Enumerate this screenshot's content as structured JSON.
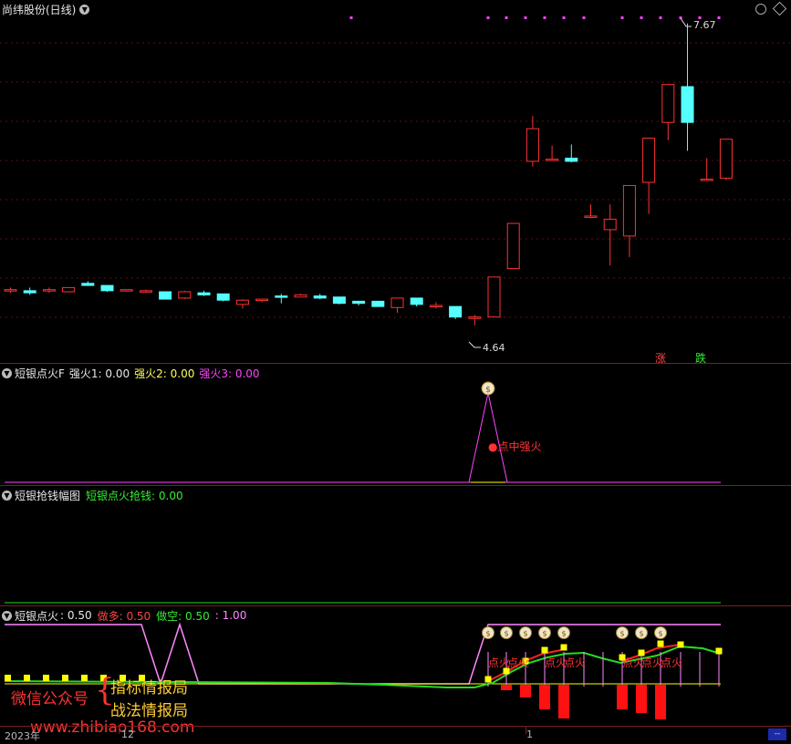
{
  "main": {
    "title": "尚纬股份(日线)",
    "high_label": "7.67",
    "low_label": "4.64",
    "up_label": "涨",
    "down_label": "跌",
    "candles": [
      {
        "o": 5.13,
        "h": 5.16,
        "l": 5.11,
        "c": 5.14
      },
      {
        "o": 5.13,
        "h": 5.16,
        "l": 5.09,
        "c": 5.11
      },
      {
        "o": 5.13,
        "h": 5.16,
        "l": 5.11,
        "c": 5.14
      },
      {
        "o": 5.12,
        "h": 5.16,
        "l": 5.12,
        "c": 5.16
      },
      {
        "o": 5.2,
        "h": 5.22,
        "l": 5.18,
        "c": 5.18
      },
      {
        "o": 5.18,
        "h": 5.18,
        "l": 5.12,
        "c": 5.13
      },
      {
        "o": 5.13,
        "h": 5.14,
        "l": 5.12,
        "c": 5.14
      },
      {
        "o": 5.13,
        "h": 5.14,
        "l": 5.11,
        "c": 5.13
      },
      {
        "o": 5.12,
        "h": 5.12,
        "l": 5.05,
        "c": 5.05
      },
      {
        "o": 5.06,
        "h": 5.13,
        "l": 5.05,
        "c": 5.12
      },
      {
        "o": 5.11,
        "h": 5.13,
        "l": 5.08,
        "c": 5.09
      },
      {
        "o": 5.1,
        "h": 5.1,
        "l": 5.03,
        "c": 5.04
      },
      {
        "o": 5.0,
        "h": 5.05,
        "l": 4.96,
        "c": 5.04
      },
      {
        "o": 5.05,
        "h": 5.05,
        "l": 5.02,
        "c": 5.05
      },
      {
        "o": 5.08,
        "h": 5.1,
        "l": 5.01,
        "c": 5.07
      },
      {
        "o": 5.07,
        "h": 5.1,
        "l": 5.07,
        "c": 5.09
      },
      {
        "o": 5.08,
        "h": 5.1,
        "l": 5.05,
        "c": 5.06
      },
      {
        "o": 5.07,
        "h": 5.07,
        "l": 5.0,
        "c": 5.01
      },
      {
        "o": 5.03,
        "h": 5.03,
        "l": 4.99,
        "c": 5.01
      },
      {
        "o": 5.03,
        "h": 5.03,
        "l": 4.98,
        "c": 4.98
      },
      {
        "o": 4.97,
        "h": 5.06,
        "l": 4.92,
        "c": 5.06
      },
      {
        "o": 5.06,
        "h": 5.06,
        "l": 4.98,
        "c": 5.0
      },
      {
        "o": 4.99,
        "h": 5.02,
        "l": 4.96,
        "c": 4.99
      },
      {
        "o": 4.98,
        "h": 4.98,
        "l": 4.86,
        "c": 4.88
      },
      {
        "o": 4.87,
        "h": 4.9,
        "l": 4.8,
        "c": 4.88
      },
      {
        "o": 4.88,
        "h": 5.26,
        "l": 4.88,
        "c": 5.26
      },
      {
        "o": 5.34,
        "h": 5.77,
        "l": 5.34,
        "c": 5.77
      },
      {
        "o": 6.36,
        "h": 6.79,
        "l": 6.31,
        "c": 6.67
      },
      {
        "o": 6.38,
        "h": 6.51,
        "l": 6.38,
        "c": 6.38
      },
      {
        "o": 6.39,
        "h": 6.52,
        "l": 6.35,
        "c": 6.36
      },
      {
        "o": 5.84,
        "h": 5.95,
        "l": 5.82,
        "c": 5.84
      },
      {
        "o": 5.71,
        "h": 5.95,
        "l": 5.37,
        "c": 5.81
      },
      {
        "o": 5.65,
        "h": 6.13,
        "l": 5.45,
        "c": 6.13
      },
      {
        "o": 6.16,
        "h": 6.49,
        "l": 5.86,
        "c": 6.58
      },
      {
        "o": 6.73,
        "h": 7.09,
        "l": 6.56,
        "c": 7.09
      },
      {
        "o": 7.07,
        "h": 7.67,
        "l": 6.46,
        "c": 6.73
      },
      {
        "o": 6.18,
        "h": 6.39,
        "l": 6.18,
        "c": 6.19
      },
      {
        "o": 6.2,
        "h": 6.57,
        "l": 6.18,
        "c": 6.57
      }
    ],
    "markers_count": 14
  },
  "panel1": {
    "name": "短银点火F",
    "items": [
      {
        "label": "强火1: 0.00",
        "color": "#e8e8e8"
      },
      {
        "label": "强火2: 0.00",
        "color": "#ffff55"
      },
      {
        "label": "强火3: 0.00",
        "color": "#ff44ff"
      }
    ],
    "annotation": "●点中强火"
  },
  "panel2": {
    "name": "短银抢钱幅图",
    "item": "短银点火抢钱: 0.00"
  },
  "panel3": {
    "name": "短银点火",
    "v1": ": 0.50",
    "v2": "做多: 0.50",
    "v3": "做空: 0.50",
    "v4": ": 1.00",
    "label_dianhuo": "点火",
    "watermark": {
      "wechat": "微信公众号",
      "line1": "指标情报局",
      "line2": "战法情报局",
      "site": "www.zhibiao168.com"
    }
  },
  "axis": {
    "left": "2023年",
    "mid1": "12",
    "mid2": "1"
  },
  "colors": {
    "up": "#ff3232",
    "down": "#54ffff",
    "magenta": "#ff44ff",
    "separator": "#7a1e1e",
    "yellow": "#ffff00",
    "green": "#22dd22"
  }
}
